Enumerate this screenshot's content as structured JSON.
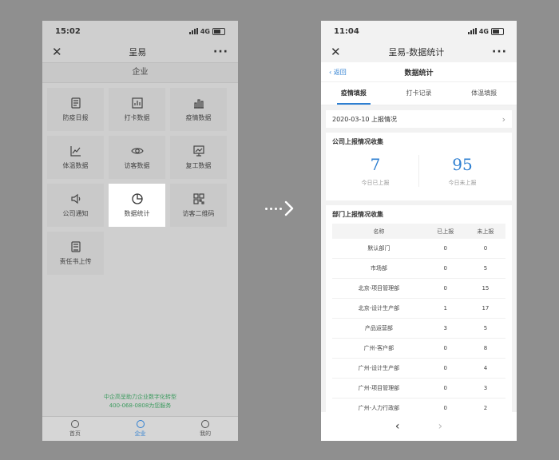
{
  "left": {
    "time": "15:02",
    "network": "4G",
    "title": "呈易",
    "section": "企业",
    "tiles": [
      {
        "label": "防疫日报",
        "icon": "scroll-icon"
      },
      {
        "label": "打卡数据",
        "icon": "bar-chart-box-icon"
      },
      {
        "label": "疫情数据",
        "icon": "bar-chart-icon"
      },
      {
        "label": "体温数据",
        "icon": "line-chart-icon"
      },
      {
        "label": "访客数据",
        "icon": "eye-icon"
      },
      {
        "label": "复工数据",
        "icon": "presentation-chart-icon"
      },
      {
        "label": "公司通知",
        "icon": "speaker-icon"
      },
      {
        "label": "数据统计",
        "icon": "pie-chart-icon"
      },
      {
        "label": "访客二维码",
        "icon": "qr-code-icon"
      },
      {
        "label": "责任书上传",
        "icon": "document-icon"
      }
    ],
    "footer": {
      "line1": "中企高呈助力企业数字化转型",
      "line2": "400-068-0808为您服务"
    },
    "tabbar": [
      {
        "label": "首页"
      },
      {
        "label": "企业"
      },
      {
        "label": "我的"
      }
    ]
  },
  "right": {
    "time": "11:04",
    "network": "4G",
    "title": "呈易-数据统计",
    "back": "返回",
    "subtitle": "数据统计",
    "tabs": [
      "疫情填报",
      "打卡记录",
      "体温填报"
    ],
    "date_row": "2020-03-10 上报情况",
    "company": {
      "title": "公司上报情况收集",
      "reported": "7",
      "reported_label": "今日已上报",
      "unreported": "95",
      "unreported_label": "今日未上报"
    },
    "dept": {
      "title": "部门上报情况收集",
      "headers": [
        "名称",
        "已上报",
        "未上报"
      ],
      "rows": [
        [
          "默认部门",
          "0",
          "0"
        ],
        [
          "市场部",
          "0",
          "5"
        ],
        [
          "北京-项目管理部",
          "0",
          "15"
        ],
        [
          "北京-设计生产部",
          "1",
          "17"
        ],
        [
          "产品运营部",
          "3",
          "5"
        ],
        [
          "广州-客户部",
          "0",
          "8"
        ],
        [
          "广州-设计生产部",
          "0",
          "4"
        ],
        [
          "广州-项目管理部",
          "0",
          "3"
        ],
        [
          "广州-人力行政部",
          "0",
          "2"
        ]
      ]
    }
  },
  "colors": {
    "accent": "#2e7fd1",
    "footer_green": "#3c9b5f"
  }
}
